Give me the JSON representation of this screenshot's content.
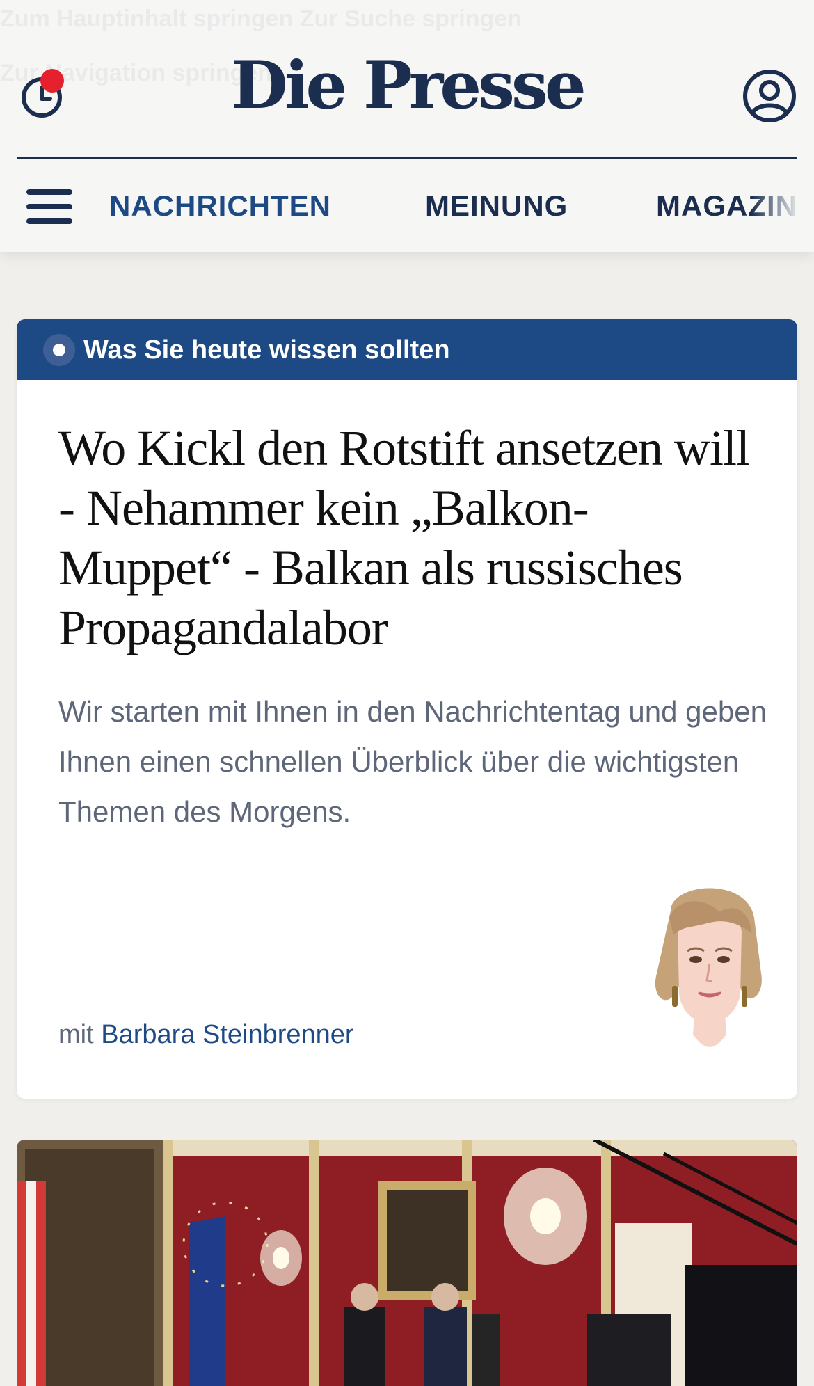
{
  "header": {
    "ghost_line_1": "Zum Hauptinhalt springen     Zur Suche springen",
    "ghost_line_2": "Zur Navigation springen",
    "logo": "Die Presse",
    "history_icon": "clock-history-icon",
    "account_icon": "user-account-icon"
  },
  "nav": {
    "menu_icon": "hamburger-menu-icon",
    "items": [
      {
        "label": "NACHRICHTEN",
        "active": true
      },
      {
        "label": "MEINUNG",
        "active": false
      },
      {
        "label": "MAGAZIN",
        "active": false
      }
    ]
  },
  "briefing_card": {
    "banner_label": "Was Sie heute wissen sollten",
    "title": "Wo Kickl den Rotstift ansetzen will - Nehammer kein „Balkon-Muppet“ - Balkan als russisches Propagandalabor",
    "teaser": "Wir starten mit Ihnen in den Nachrichtentag und geben Ihnen einen schnellen Überblick über die wichtigsten Themen des Morgens.",
    "byline_prefix": "mit",
    "author": "Barbara Steinbrenner"
  },
  "colors": {
    "brand_navy": "#1c2e4f",
    "accent_blue": "#1d4a85",
    "notification_red": "#e5212e",
    "teaser_gray": "#5e6679",
    "page_background": "#f1efeb"
  }
}
